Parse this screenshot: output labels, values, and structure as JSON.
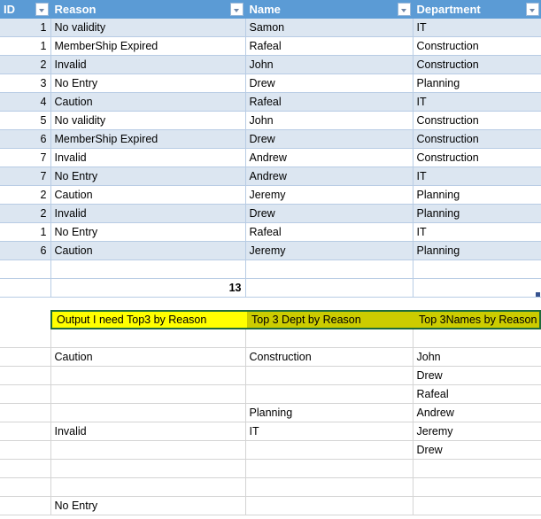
{
  "app": {
    "type": "spreadsheet"
  },
  "data_table": {
    "columns": [
      {
        "key": "id",
        "label": "ID"
      },
      {
        "key": "reason",
        "label": "Reason"
      },
      {
        "key": "name",
        "label": "Name"
      },
      {
        "key": "department",
        "label": "Department"
      }
    ],
    "rows": [
      {
        "id": "1",
        "reason": "No validity",
        "name": "Samon",
        "department": "IT"
      },
      {
        "id": "1",
        "reason": "MemberShip Expired",
        "name": "Rafeal",
        "department": "Construction"
      },
      {
        "id": "2",
        "reason": "Invalid",
        "name": "John",
        "department": "Construction"
      },
      {
        "id": "3",
        "reason": "No Entry",
        "name": "Drew",
        "department": "Planning"
      },
      {
        "id": "4",
        "reason": "Caution",
        "name": "Rafeal",
        "department": "IT"
      },
      {
        "id": "5",
        "reason": "No validity",
        "name": "John",
        "department": "Construction"
      },
      {
        "id": "6",
        "reason": "MemberShip Expired",
        "name": "Drew",
        "department": "Construction"
      },
      {
        "id": "7",
        "reason": "Invalid",
        "name": "Andrew",
        "department": "Construction"
      },
      {
        "id": "7",
        "reason": "No Entry",
        "name": "Andrew",
        "department": "IT"
      },
      {
        "id": "2",
        "reason": "Caution",
        "name": "Jeremy",
        "department": "Planning"
      },
      {
        "id": "2",
        "reason": "Invalid",
        "name": "Drew",
        "department": "Planning"
      },
      {
        "id": "1",
        "reason": "No Entry",
        "name": "Rafeal",
        "department": "IT"
      },
      {
        "id": "6",
        "reason": "Caution",
        "name": "Jeremy",
        "department": "Planning"
      }
    ],
    "total_row": {
      "id": "",
      "reason": "13",
      "name": "",
      "department": ""
    }
  },
  "banner": {
    "col1": "Output I need Top3 by Reason",
    "col2": "Top 3  Dept by Reason",
    "col3": "Top 3Names by Reason",
    "fill_bright": "#ffff00",
    "fill_dark": "#cccc00",
    "border_color": "#1f6b3b"
  },
  "output": {
    "rows": [
      {
        "id": "",
        "reason": "",
        "name": "",
        "department": ""
      },
      {
        "id": "",
        "reason": "Caution",
        "name": "Construction",
        "department": "John"
      },
      {
        "id": "",
        "reason": "",
        "name": "",
        "department": "Drew"
      },
      {
        "id": "",
        "reason": "",
        "name": "",
        "department": "Rafeal"
      },
      {
        "id": "",
        "reason": "",
        "name": "Planning",
        "department": "Andrew"
      },
      {
        "id": "",
        "reason": "Invalid",
        "name": "IT",
        "department": "Jeremy"
      },
      {
        "id": "",
        "reason": "",
        "name": "",
        "department": "Drew"
      },
      {
        "id": "",
        "reason": "",
        "name": "",
        "department": ""
      },
      {
        "id": "",
        "reason": "",
        "name": "",
        "department": ""
      },
      {
        "id": "",
        "reason": "No Entry",
        "name": "",
        "department": ""
      }
    ]
  },
  "theme": {
    "header_blue": "#5b9bd5",
    "band_blue": "#dce6f1",
    "grid_line": "#b8cce4",
    "plain_grid_line": "#d4d4d4"
  }
}
